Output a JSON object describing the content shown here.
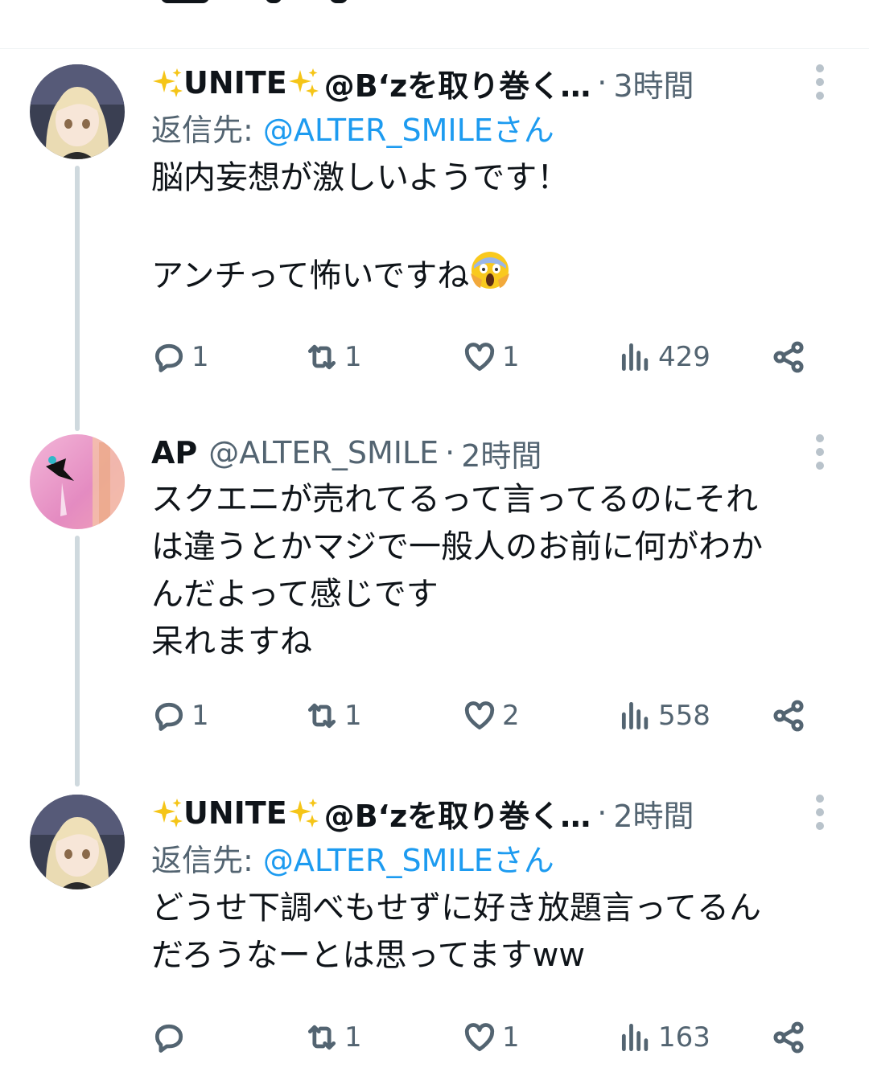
{
  "tweets": [
    {
      "display_name": "UNITE",
      "handle": "@B‘zを取り巻く…",
      "separator": "·",
      "time": "3時間",
      "reply_prefix": "返信先: ",
      "reply_handle": "@ALTER_SMILEさん",
      "body_line1": "脳内妄想が激しいようです！",
      "body_line2": "アンチって怖いですね",
      "emoji": "face-screaming-in-fear",
      "replies": "1",
      "retweets": "1",
      "likes": "1",
      "views": "429"
    },
    {
      "display_name": "AP",
      "handle": "@ALTER_SMILE",
      "separator": "·",
      "time": "2時間",
      "body": "スクエニが売れてるって言ってるのにそれ\nは違うとかマジで一般人のお前に何がわか\nんだよって感じです\n呆れますね",
      "replies": "1",
      "retweets": "1",
      "likes": "2",
      "views": "558"
    },
    {
      "display_name": "UNITE",
      "handle": "@B‘zを取り巻く…",
      "separator": "·",
      "time": "2時間",
      "reply_prefix": "返信先: ",
      "reply_handle": "@ALTER_SMILEさん",
      "body": "どうせ下調べもせずに好き放題言ってるん\nだろうなーとは思ってますww",
      "replies": "",
      "retweets": "1",
      "likes": "1",
      "views": "163"
    }
  ],
  "colors": {
    "link": "#1d9bf0",
    "muted": "#536471",
    "text": "#0f1419",
    "thread": "#cfd9de"
  },
  "icons": [
    "reply-icon",
    "retweet-icon",
    "like-icon",
    "views-icon",
    "share-icon",
    "more-icon",
    "sparkles-icon"
  ]
}
